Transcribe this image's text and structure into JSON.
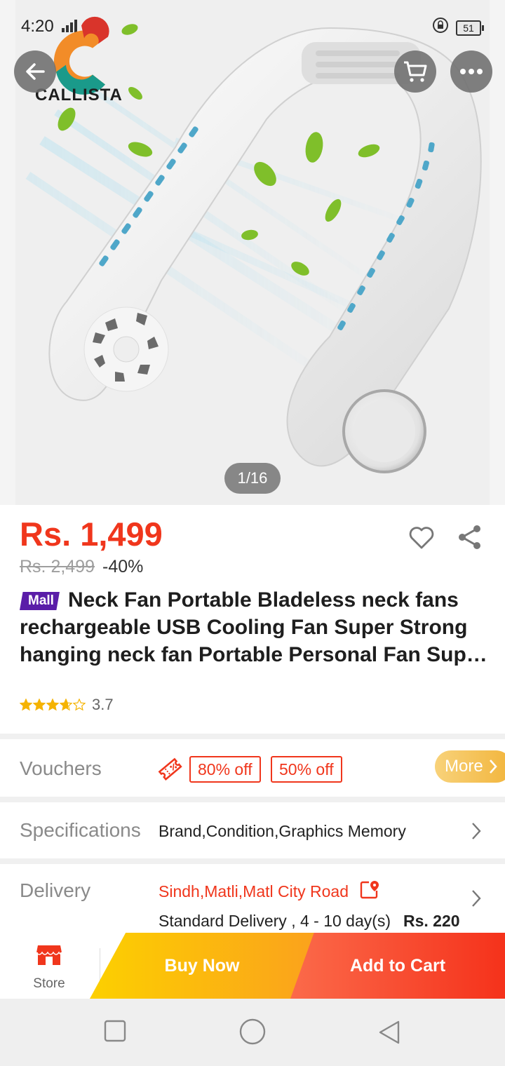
{
  "status_bar": {
    "time": "4:20",
    "battery": "51"
  },
  "brand_logo": {
    "text": "CALLISTA"
  },
  "image_pager": {
    "current": 1,
    "total": 16,
    "label": "1/16"
  },
  "product": {
    "price": "Rs. 1,499",
    "original_price": "Rs. 2,499",
    "discount": "-40%",
    "badge": "Mall",
    "title_lines": [
      "Neck Fan Portable Bladeless neck fans",
      "rechargeable USB Cooling Fan Super Strong",
      "hanging neck fan Portable Personal Fan Supe..."
    ],
    "rating": 3.7,
    "rating_label": "3.7"
  },
  "vouchers": {
    "label": "Vouchers",
    "tags": [
      "80% off",
      "50% off"
    ],
    "more_label": "More"
  },
  "specifications": {
    "label": "Specifications",
    "value": "Brand,Condition,Graphics Memory"
  },
  "delivery": {
    "label": "Delivery",
    "address": "Sindh,Matli,Matl City Road",
    "info": "Standard Delivery , 4 - 10 day(s)",
    "fee": "Rs. 220"
  },
  "action_bar": {
    "store_label": "Store",
    "buy_now_label": "Buy Now",
    "add_to_cart_label": "Add to Cart"
  },
  "colors": {
    "accent": "#f0361c",
    "buy_now": "#fcb80f",
    "mall_badge": "#5a1da8",
    "star": "#f5b301"
  },
  "icons": [
    "back-arrow-icon",
    "cart-icon",
    "more-dots-icon",
    "heart-icon",
    "share-icon",
    "voucher-ticket-icon",
    "chevron-right-icon",
    "location-edit-icon",
    "store-icon",
    "nav-square-icon",
    "nav-circle-icon",
    "nav-triangle-icon"
  ]
}
